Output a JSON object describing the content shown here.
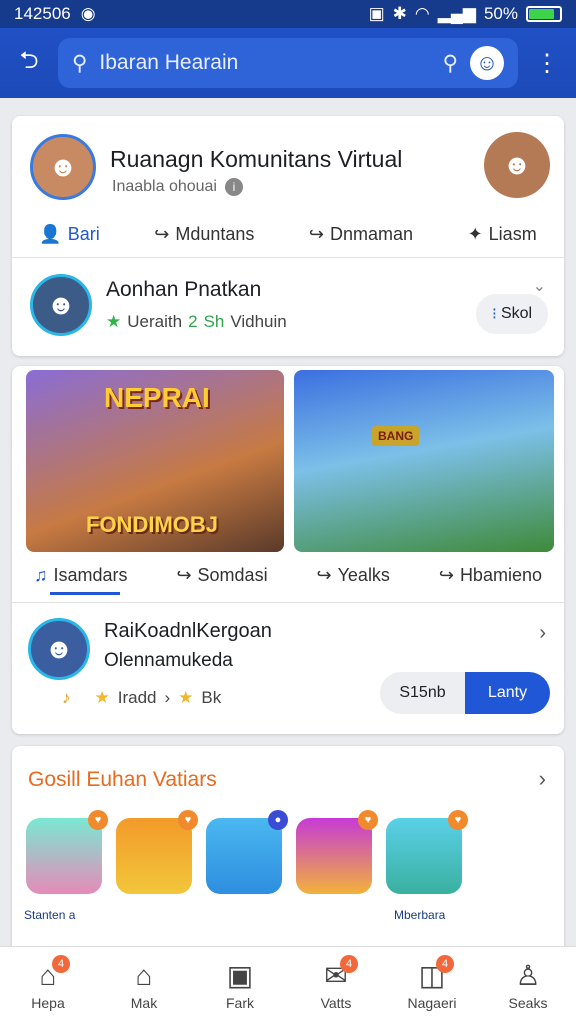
{
  "status": {
    "time": "142506",
    "battery": "50%"
  },
  "search": {
    "placeholder": "Ibaran Hearain"
  },
  "community": {
    "title": "Ruanagn Komunitans Virtual",
    "subtitle": "Inaabla ohouai",
    "actions": [
      "Bari",
      "Mduntans",
      "Dnmaman",
      "Liasm"
    ]
  },
  "user": {
    "name": "Aonhan Pnatkan",
    "status_a": "Ueraith",
    "status_num": "2",
    "status_b": "Sh",
    "status_c": "Vidhuin",
    "button": "Skol"
  },
  "media": {
    "poster_text_top": "NEPRAI",
    "poster_text_bottom": "FONDIMOBJ",
    "stage_sign": "BANG",
    "tabs": [
      "Isamdars",
      "Somdasi",
      "Yealks",
      "Hbamieno"
    ]
  },
  "invite": {
    "name": "RaiKoadnlKergoan",
    "line2": "Olennamukeda",
    "tag1": "Iradd",
    "tag2": "Bk",
    "btn_left": "S15nb",
    "btn_right": "Lanty"
  },
  "apps": {
    "title": "Gosill Euhan Vatiars",
    "label_left": "Stanten a",
    "label_right": "Mberbara"
  },
  "nav": [
    {
      "label": "Hepa",
      "badge": "4"
    },
    {
      "label": "Mak",
      "badge": ""
    },
    {
      "label": "Fark",
      "badge": ""
    },
    {
      "label": "Vatts",
      "badge": "4"
    },
    {
      "label": "Nagaeri",
      "badge": "4"
    },
    {
      "label": "Seaks",
      "badge": ""
    }
  ],
  "colors": {
    "primary": "#1f57d6",
    "header": "#2050c6"
  }
}
